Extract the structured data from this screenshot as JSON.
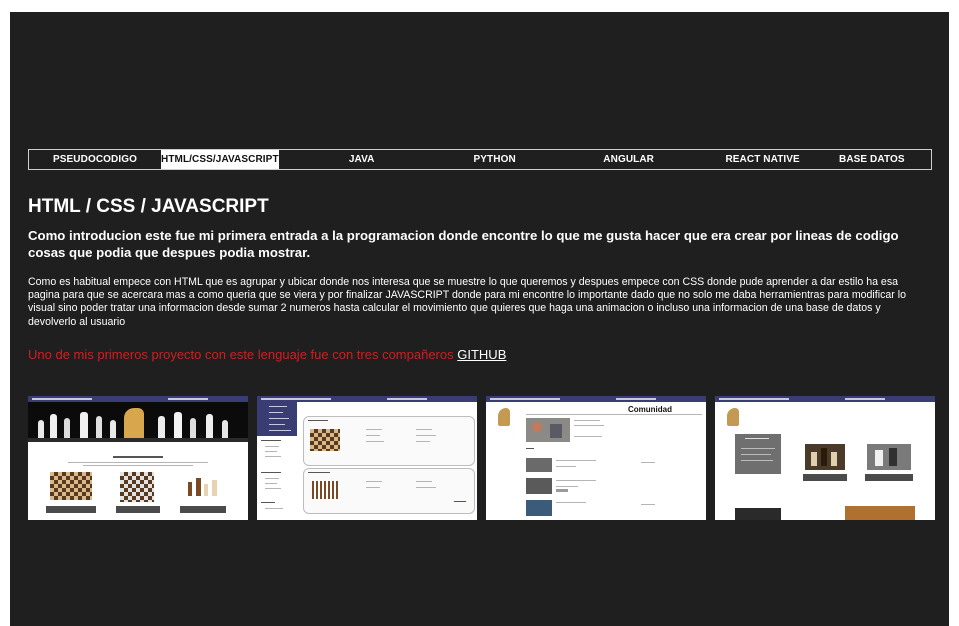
{
  "tabs": [
    {
      "label": "PSEUDOCODIGO",
      "active": false
    },
    {
      "label": "HTML/CSS/JAVASCRIPT",
      "active": true
    },
    {
      "label": "JAVA",
      "active": false
    },
    {
      "label": "PYTHON",
      "active": false
    },
    {
      "label": "ANGULAR",
      "active": false
    },
    {
      "label": "REACT NATIVE",
      "active": false
    },
    {
      "label": "BASE DATOS",
      "active": false
    }
  ],
  "section": {
    "title": "HTML / CSS / JAVASCRIPT",
    "intro": "Como introducion este fue mi primera entrada a la programacion donde encontre lo que me gusta hacer que era crear por lineas de codigo cosas que podia que despues podia mostrar.",
    "body": "Como es habitual empece con HTML que es agrupar y ubicar donde nos interesa que se muestre lo que queremos y despues empece con CSS donde pude aprender a dar estilo ha esa pagina para que se acercara mas a como queria que se viera y por finalizar JAVASCRIPT donde para mi encontre lo importante dado que no solo me daba herramientras para modificar lo visual sino poder tratar una informacion desde sumar 2 numeros hasta calcular el movimiento que quieres que haga una animacion o incluso una informacion de una base de datos y devolverlo al usuario",
    "project_text": "Uno de mis primeros proyecto con este lenguaje fue con tres compañeros",
    "project_link": "GITHUB"
  },
  "colors": {
    "background": "#1f1f1f",
    "text": "#ffffff",
    "accent_red": "#d11e22",
    "nav_blue": "#3a3d74"
  },
  "thumbnails": [
    {
      "name": "screenshot-home"
    },
    {
      "name": "screenshot-catalog"
    },
    {
      "name": "screenshot-comunidad",
      "heading": "Comunidad"
    },
    {
      "name": "screenshot-categories"
    }
  ]
}
